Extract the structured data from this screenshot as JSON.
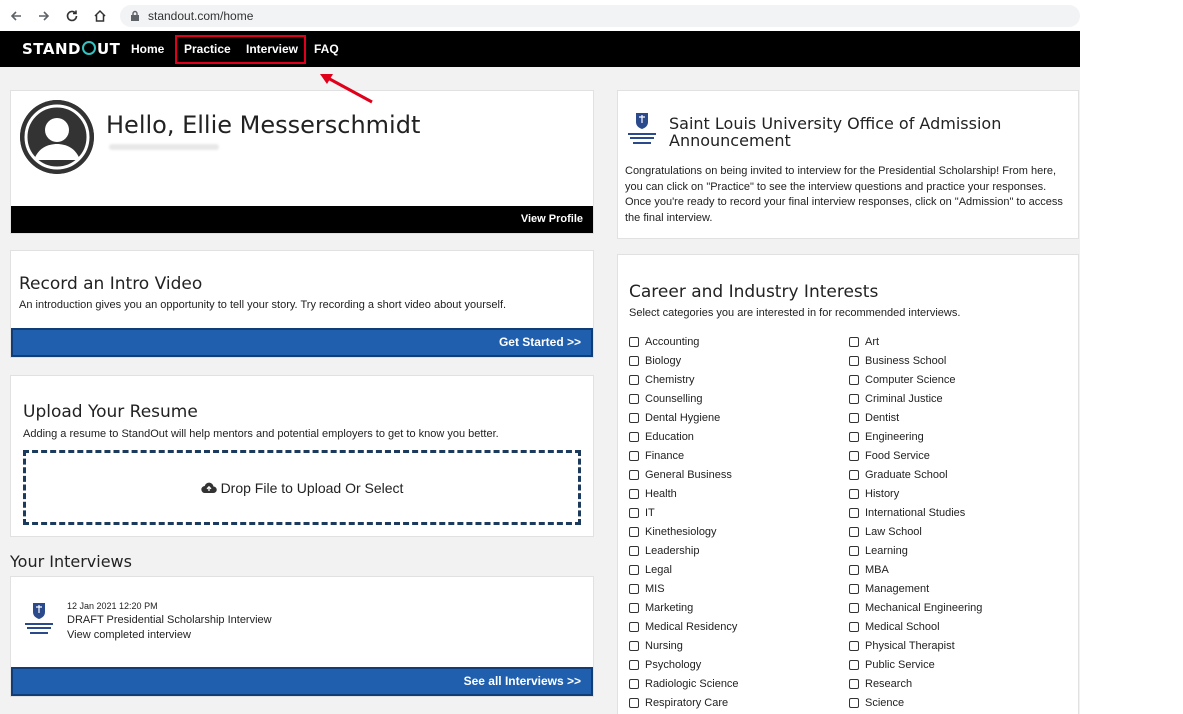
{
  "browser": {
    "url": "standout.com/home"
  },
  "nav": {
    "logo": "STANDOUT",
    "links": {
      "home": "Home",
      "practice": "Practice",
      "interview": "Interview",
      "faq": "FAQ"
    }
  },
  "colors": {
    "nav_bg": "#000000",
    "accent_blue": "#1f5fae",
    "annotation_red": "#e0001b",
    "page_bg": "#f2f2f2"
  },
  "profile": {
    "greeting": "Hello, Ellie Messerschmidt",
    "view_profile": "View Profile"
  },
  "intro_video": {
    "title": "Record an Intro Video",
    "description": "An introduction gives you an opportunity to tell your story. Try recording a short video about yourself.",
    "cta": "Get Started >>"
  },
  "resume": {
    "title": "Upload Your Resume",
    "description": "Adding a resume to StandOut will help mentors and potential employers to get to know you better.",
    "dropzone": "Drop File to Upload Or Select"
  },
  "interviews": {
    "section_title": "Your Interviews",
    "items": [
      {
        "date": "12 Jan 2021 12:20 PM",
        "title": "DRAFT Presidential Scholarship Interview",
        "action": "View completed interview"
      }
    ],
    "see_all": "See all Interviews >>"
  },
  "announcement": {
    "title": "Saint Louis University Office of Admission Announcement",
    "body": "Congratulations on being invited to interview for the Presidential Scholarship! From here, you can click on \"Practice\" to see the interview questions and practice your responses. Once you're ready to record your final interview responses, click on \"Admission\" to access the final interview."
  },
  "career": {
    "title": "Career and Industry Interests",
    "description": "Select categories you are interested in for recommended interviews.",
    "left": [
      "Accounting",
      "Biology",
      "Chemistry",
      "Counselling",
      "Dental Hygiene",
      "Education",
      "Finance",
      "General Business",
      "Health",
      "IT",
      "Kinethesiology",
      "Leadership",
      "Legal",
      "MIS",
      "Marketing",
      "Medical Residency",
      "Nursing",
      "Psychology",
      "Radiologic Science",
      "Respiratory Care"
    ],
    "right": [
      "Art",
      "Business School",
      "Computer Science",
      "Criminal Justice",
      "Dentist",
      "Engineering",
      "Food Service",
      "Graduate School",
      "History",
      "International Studies",
      "Law School",
      "Learning",
      "MBA",
      "Management",
      "Mechanical Engineering",
      "Medical School",
      "Physical Therapist",
      "Public Service",
      "Research",
      "Science"
    ]
  }
}
